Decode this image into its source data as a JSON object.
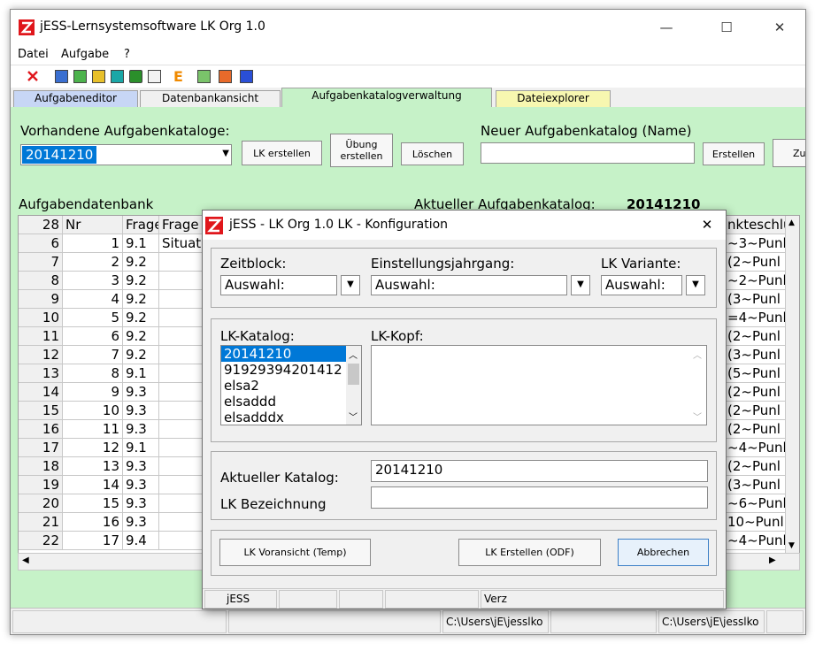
{
  "app": {
    "title": "jESS-Lernsystemsoftware LK Org 1.0",
    "minimize": "—",
    "maximize": "☐",
    "close": "✕"
  },
  "menu": [
    "Datei",
    "Aufgabe",
    "?"
  ],
  "tabs": [
    "Aufgabeneditor",
    "Datenbankansicht",
    "Aufgabenkatalogverwaltung",
    "Dateiexplorer"
  ],
  "top_panel": {
    "existing_label": "Vorhandene Aufgabenkataloge:",
    "existing_value": "20141210",
    "btn_lk_erstellen": "LK erstellen",
    "btn_uebung_1": "Übung",
    "btn_uebung_2": "erstellen",
    "btn_loeschen": "Löschen",
    "new_label": "Neuer Aufgabenkatalog (Name)",
    "new_value": "",
    "btn_erstellen": "Erstellen",
    "btn_cut": "Zu"
  },
  "db_panel": {
    "title": "Aufgabendatenbank",
    "header": [
      "28",
      "Nr",
      "Frage",
      "Frage"
    ],
    "rows": [
      [
        "6",
        "1",
        "9.1",
        "Situat"
      ],
      [
        "7",
        "2",
        "9.2",
        ""
      ],
      [
        "8",
        "3",
        "9.2",
        ""
      ],
      [
        "9",
        "4",
        "9.2",
        ""
      ],
      [
        "10",
        "5",
        "9.2",
        ""
      ],
      [
        "11",
        "6",
        "9.2",
        ""
      ],
      [
        "12",
        "7",
        "9.2",
        ""
      ],
      [
        "13",
        "8",
        "9.1",
        ""
      ],
      [
        "14",
        "9",
        "9.3",
        ""
      ],
      [
        "15",
        "10",
        "9.3",
        ""
      ],
      [
        "16",
        "11",
        "9.3",
        ""
      ],
      [
        "17",
        "12",
        "9.1",
        ""
      ],
      [
        "18",
        "13",
        "9.3",
        ""
      ],
      [
        "19",
        "14",
        "9.3",
        ""
      ],
      [
        "20",
        "15",
        "9.3",
        ""
      ],
      [
        "21",
        "16",
        "9.3",
        ""
      ],
      [
        "22",
        "17",
        "9.4",
        ""
      ]
    ]
  },
  "catalog_panel": {
    "label": "Aktueller Aufgabenkatalog:",
    "value": "20141210",
    "col_header": "nkteschlü",
    "cells": [
      "~3~Punl",
      "(2~Punl",
      "~2~Punl",
      "(3~Punl",
      "=4~Punl",
      "(2~Punl",
      "(3~Punl",
      "(5~Punl",
      "(2~Punl",
      "(2~Punl",
      "(2~Punl",
      "~4~Punl",
      "(2~Punl",
      "(3~Punl",
      "~6~Punl",
      "10~Punl",
      "~4~Punl"
    ]
  },
  "statusbar": {
    "path1": "C:\\Users\\jE\\jesslko",
    "path2": "C:\\Users\\jE\\jesslko"
  },
  "dialog": {
    "title": "jESS - LK Org 1.0 LK - Konfiguration",
    "close": "✕",
    "zeitblock_label": "Zeitblock:",
    "zeitblock_value": "Auswahl:",
    "jahrgang_label": "Einstellungsjahrgang:",
    "jahrgang_value": "Auswahl:",
    "variante_label": "LK Variante:",
    "variante_value": "Auswahl:",
    "katalog_label": "LK-Katalog:",
    "katalog_items": [
      "20141210",
      "91929394201412",
      "elsa2",
      "elsaddd",
      "elsadddx"
    ],
    "kopf_label": "LK-Kopf:",
    "kopf_value": "",
    "aktueller_label": "Aktueller Katalog:",
    "aktueller_value": "20141210",
    "bezeichnung_label": "LK Bezeichnung",
    "bezeichnung_value": "",
    "btn_voransicht": "LK Voransicht (Temp)",
    "btn_erstellen": "LK Erstellen (ODF)",
    "btn_abbrechen": "Abbrechen",
    "status_1": "jESS",
    "status_2": "Verz"
  },
  "colors": {
    "panel_green": "#c6f2c8",
    "tab_blue": "#c7d6f5",
    "tab_green": "#c6f2c8",
    "tab_yellow": "#f7f7b0",
    "selection": "#0078d7",
    "logo_red": "#e0161b"
  }
}
